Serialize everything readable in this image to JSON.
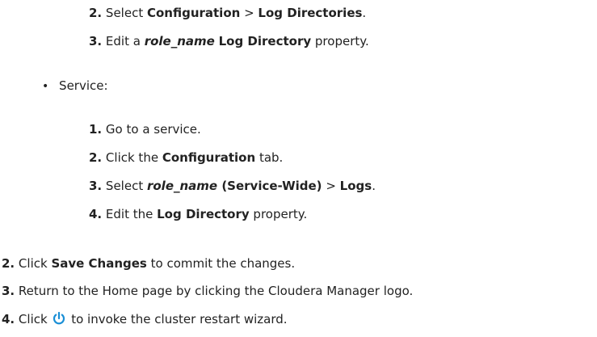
{
  "nested_steps_a": [
    {
      "num": "2.",
      "t1": "Select ",
      "b1": "Configuration",
      "t2": " > ",
      "b2": "Log Directories",
      "t3": "."
    },
    {
      "num": "3.",
      "t1": "Edit a ",
      "bi1": "role_name",
      "t2": " ",
      "b1": "Log Directory",
      "t3": " property."
    }
  ],
  "service_bullet": {
    "symbol": "•",
    "label": "Service:"
  },
  "service_steps": [
    {
      "num": "1.",
      "text": "Go to a service."
    },
    {
      "num": "2.",
      "t1": "Click the ",
      "b1": "Configuration",
      "t2": " tab."
    },
    {
      "num": "3.",
      "t1": "Select ",
      "bi1": "role_name",
      "b1": " (Service-Wide)",
      "t2": " > ",
      "b2": "Logs",
      "t3": "."
    },
    {
      "num": "4.",
      "t1": "Edit the ",
      "b1": "Log Directory",
      "t2": " property."
    }
  ],
  "main_steps": [
    {
      "num": "2.",
      "t1": "Click ",
      "b1": "Save Changes",
      "t2": " to commit the changes."
    },
    {
      "num": "3.",
      "text": "Return to the Home page by clicking the Cloudera Manager logo."
    },
    {
      "num": "4.",
      "t1": "Click ",
      "icon": "restart-icon",
      "t2": " to invoke the cluster restart wizard."
    }
  ],
  "colors": {
    "text": "#222222",
    "icon": "#1a8fd6"
  }
}
